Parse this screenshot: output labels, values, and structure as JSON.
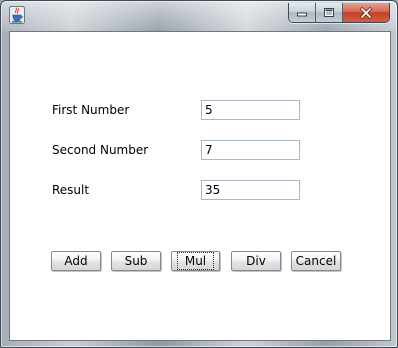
{
  "window": {
    "icon": "java-coffee-cup-icon",
    "controls": [
      "minimize-icon",
      "maximize-icon",
      "close-icon"
    ]
  },
  "form": {
    "first": {
      "label": "First Number",
      "value": "5"
    },
    "second": {
      "label": "Second Number",
      "value": "7"
    },
    "result": {
      "label": "Result",
      "value": "35"
    }
  },
  "buttons": {
    "add": "Add",
    "sub": "Sub",
    "mul": "Mul",
    "div": "Div",
    "cancel": "Cancel"
  },
  "colors": {
    "close_button": "#c7432b",
    "field_border": "#a9b8c6"
  }
}
